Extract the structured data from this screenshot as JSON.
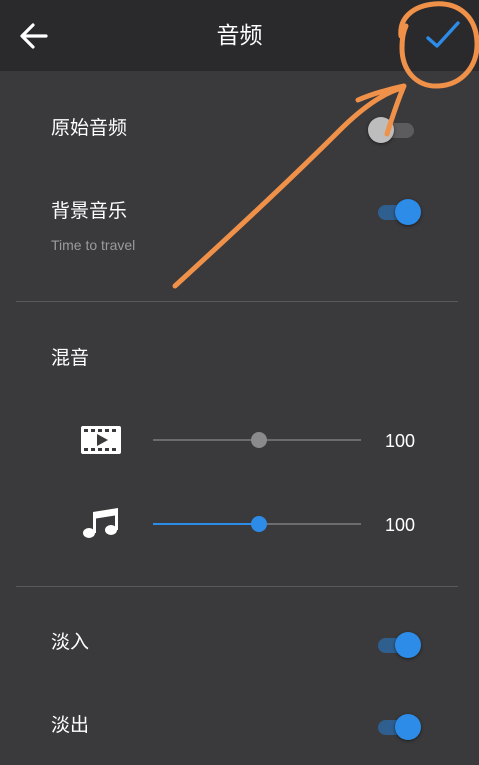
{
  "header": {
    "title": "音频",
    "back_icon": "arrow-left-icon",
    "confirm_icon": "checkmark-icon"
  },
  "sections": {
    "original_audio": {
      "label": "原始音频",
      "enabled": false
    },
    "background_music": {
      "label": "背景音乐",
      "track_name": "Time to travel",
      "enabled": true
    },
    "mix": {
      "label": "混音",
      "video_volume": {
        "icon": "video-film-icon",
        "value": "100",
        "level": 0.5
      },
      "music_volume": {
        "icon": "music-note-icon",
        "value": "100",
        "level": 0.5
      }
    },
    "fade_in": {
      "label": "淡入",
      "enabled": true
    },
    "fade_out": {
      "label": "淡出",
      "enabled": true
    }
  },
  "colors": {
    "accent": "#2d8ce8",
    "annotation": "#f0914a"
  }
}
